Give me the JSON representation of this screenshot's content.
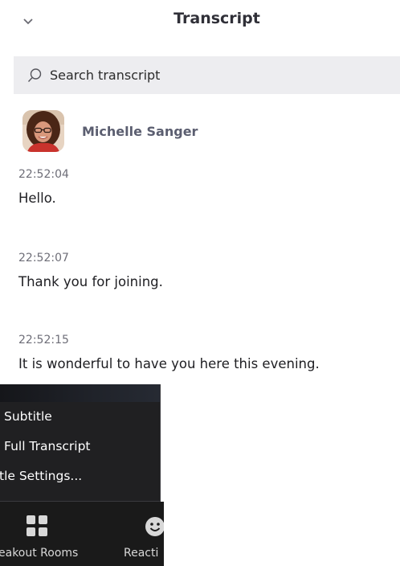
{
  "header": {
    "title": "Transcript",
    "collapse_icon": "chevron-down-icon"
  },
  "search": {
    "placeholder": "Search transcript",
    "value": "",
    "icon": "search-icon"
  },
  "speaker": {
    "name": "Michelle Sanger"
  },
  "entries": [
    {
      "time": "22:52:04",
      "text": "Hello."
    },
    {
      "time": "22:52:07",
      "text": "Thank you for joining."
    },
    {
      "time": "22:52:15",
      "text": "It is wonderful to have you here this evening."
    }
  ],
  "menu": {
    "items": [
      {
        "label": "Subtitle"
      },
      {
        "label": "Full Transcript"
      },
      {
        "label": "tle Settings..."
      }
    ]
  },
  "toolbar": {
    "breakout_label": "eakout Rooms",
    "breakout_icon": "grid-icon",
    "reactions_label": "Reacti",
    "reactions_icon": "smiley-icon"
  },
  "colors": {
    "title": "#303038",
    "speaker_name": "#5b5e70",
    "timestamp": "#6e6e78",
    "search_bg": "#ededf0",
    "menu_bg": "#202022",
    "toolbar_bg": "#1a1a1a"
  }
}
